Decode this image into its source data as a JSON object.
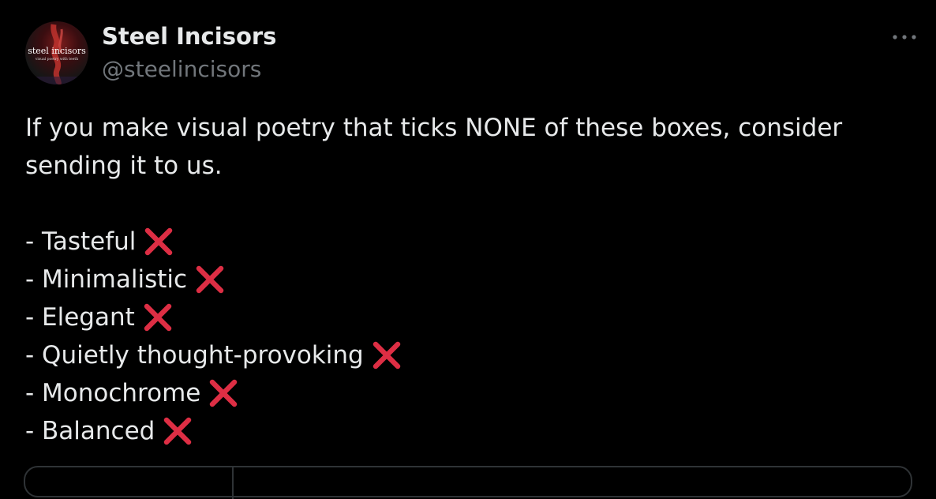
{
  "post": {
    "display_name": "Steel Incisors",
    "handle": "@steelincisors",
    "avatar": {
      "logo_text": "steel incisors",
      "logo_subtext": "visual poetry with teeth"
    },
    "more_icon": "more-horizontal-icon",
    "text_intro": "If you make visual poetry that ticks NONE of these boxes, consider sending it to us.",
    "list_items": [
      {
        "label": "- Tasteful"
      },
      {
        "label": "- Minimalistic"
      },
      {
        "label": "- Elegant"
      },
      {
        "label": "- Quietly thought-provoking"
      },
      {
        "label": "- Monochrome"
      },
      {
        "label": "- Balanced"
      }
    ],
    "cross_icon": "cross-mark-icon"
  },
  "colors": {
    "background": "#000000",
    "text_primary": "#e7e9ea",
    "text_secondary": "#71767b",
    "cross_mark": "#dd2e44",
    "border": "#2f3336"
  }
}
